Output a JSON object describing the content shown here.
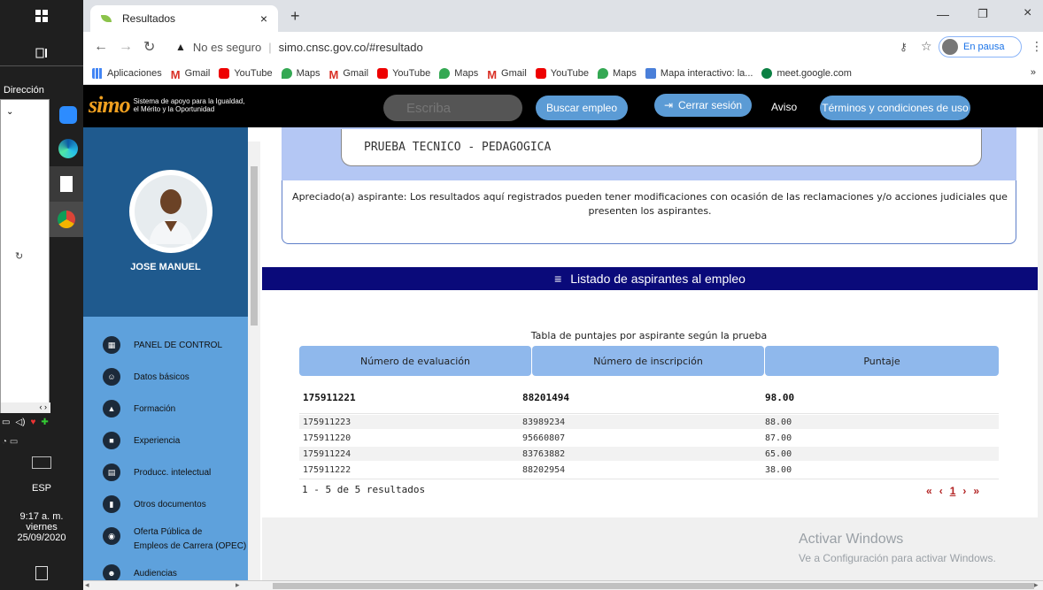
{
  "taskbar": {
    "direccion_label": "Dirección",
    "lang": "ESP",
    "time": "9:17 a. m.",
    "weekday": "viernes",
    "date": "25/09/2020"
  },
  "browser": {
    "tab_title": "Resultados",
    "security_text": "No es seguro",
    "url": "simo.cnsc.gov.co/#resultado",
    "profile_label": "En pausa",
    "bookmarks": [
      "Aplicaciones",
      "Gmail",
      "YouTube",
      "Maps",
      "Gmail",
      "YouTube",
      "Maps",
      "Gmail",
      "YouTube",
      "Maps",
      "Mapa interactivo: la...",
      "meet.google.com"
    ]
  },
  "site": {
    "logo_text": "simo",
    "tagline_1": "Sistema de apoyo para la Igualdad,",
    "tagline_2": "el Mérito y la Oportunidad",
    "search_placeholder": "Escriba",
    "search_button": "Buscar empleo",
    "logout_button": "Cerrar sesión",
    "aviso_link": "Aviso",
    "terms_button": "Términos y condiciones de uso"
  },
  "sidebar": {
    "user_name": "JOSE MANUEL",
    "items": [
      {
        "label": "PANEL DE CONTROL",
        "icon": "dashboard-icon"
      },
      {
        "label": "Datos básicos",
        "icon": "people-icon"
      },
      {
        "label": "Formación",
        "icon": "graduation-icon"
      },
      {
        "label": "Experiencia",
        "icon": "briefcase-icon"
      },
      {
        "label": "Producc. intelectual",
        "icon": "book-icon"
      },
      {
        "label": "Otros documentos",
        "icon": "document-icon"
      },
      {
        "label": "Oferta Pública de",
        "label2": "Empleos de Carrera (OPEC)",
        "icon": "globe-icon"
      },
      {
        "label": "Audiencias",
        "icon": "audience-icon"
      }
    ]
  },
  "main": {
    "prueba_title": "PRUEBA TECNICO - PEDAGOGICA",
    "notice": "Apreciado(a) aspirante: Los resultados aquí registrados pueden tener modificaciones con ocasión de las reclamaciones y/o acciones judiciales que presenten los aspirantes.",
    "list_title": "Listado de aspirantes al empleo",
    "table_caption": "Tabla de puntajes por aspirante según la prueba",
    "columns": [
      "Número de evaluación",
      "Número de inscripción",
      "Puntaje"
    ],
    "rows": [
      [
        "175911221",
        "88201494",
        "98.00"
      ],
      [
        "175911223",
        "83989234",
        "88.00"
      ],
      [
        "175911220",
        "95660807",
        "87.00"
      ],
      [
        "175911224",
        "83763882",
        "65.00"
      ],
      [
        "175911222",
        "88202954",
        "38.00"
      ]
    ],
    "results_count": "1 - 5 de 5 resultados",
    "pager": {
      "first": "«",
      "prev": "‹",
      "page": "1",
      "next": "›",
      "last": "»"
    }
  },
  "watermark": {
    "line1": "Activar Windows",
    "line2": "Ve a Configuración para activar Windows."
  }
}
